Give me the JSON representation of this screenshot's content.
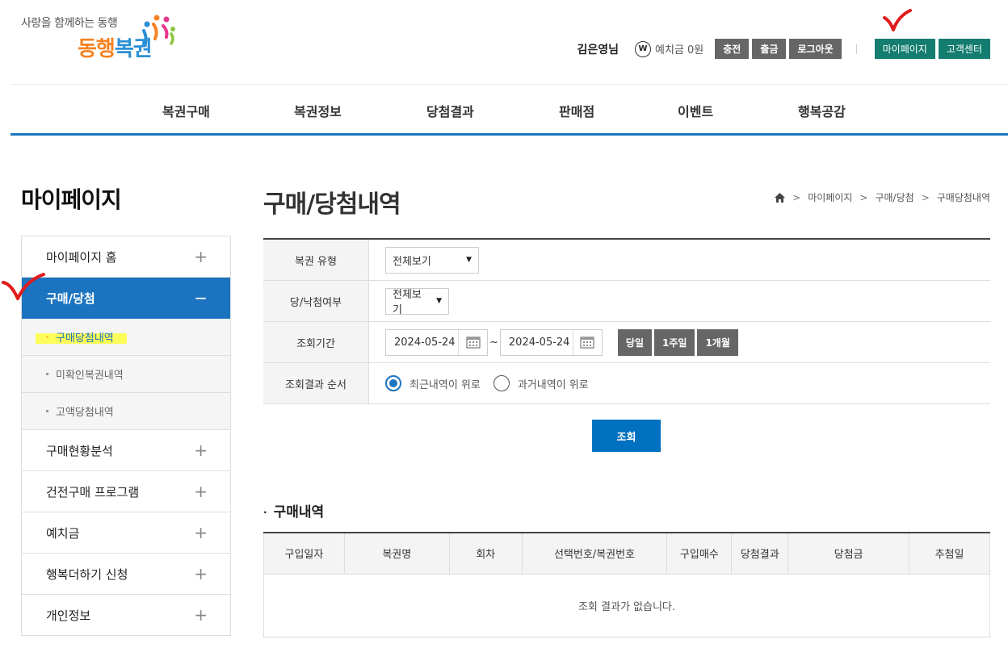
{
  "header": {
    "logo_tagline": "사랑을 함께하는 동행",
    "logo_name_1": "동행",
    "logo_name_2": "복권",
    "user_name": "김은영님",
    "w_icon_text": "W",
    "deposit_text": "예치금 0원",
    "buttons": {
      "charge": "충전",
      "withdraw": "출금",
      "logout": "로그아웃",
      "mypage": "마이페이지",
      "support": "고객센터"
    }
  },
  "gnb": [
    "복권구매",
    "복권정보",
    "당첨결과",
    "판매점",
    "이벤트",
    "행복공감"
  ],
  "sidebar": {
    "title": "마이페이지",
    "items": [
      {
        "label": "마이페이지 홈",
        "toggle": "+"
      },
      {
        "label": "구매/당첨",
        "toggle": "−"
      },
      {
        "label": "구매현황분석",
        "toggle": "+"
      },
      {
        "label": "건전구매 프로그램",
        "toggle": "+"
      },
      {
        "label": "예치금",
        "toggle": "+"
      },
      {
        "label": "행복더하기 신청",
        "toggle": "+"
      },
      {
        "label": "개인정보",
        "toggle": "+"
      }
    ],
    "subitems": [
      "구매당첨내역",
      "미확인복권내역",
      "고액당첨내역"
    ]
  },
  "main": {
    "title": "구매/당첨내역",
    "breadcrumb": [
      "마이페이지",
      "구매/당첨",
      "구매당첨내역"
    ],
    "search": {
      "lottery_type_label": "복권 유형",
      "lottery_type_value": "전체보기",
      "win_label": "당/낙첨여부",
      "win_value": "전체보기",
      "period_label": "조회기간",
      "date_from": "2024-05-24",
      "date_sep": "~",
      "date_to": "2024-05-24",
      "period_buttons": [
        "당일",
        "1주일",
        "1개월"
      ],
      "order_label": "조회결과 순서",
      "order_options": [
        "최근내역이 위로",
        "과거내역이 위로"
      ],
      "order_selected": "최근내역이 위로",
      "submit": "조회"
    },
    "history": {
      "section_bullet": "·",
      "section_title": "구매내역",
      "columns": [
        "구입일자",
        "복권명",
        "회차",
        "선택번호/복권번호",
        "구입매수",
        "당첨결과",
        "당첨금",
        "추첨일"
      ],
      "empty_message": "조회 결과가 없습니다."
    }
  },
  "colors": {
    "primary": "#1c74c0",
    "teal": "#137d6f",
    "gray_button": "#666666",
    "annotation_red": "#e21b1b",
    "highlight": "#ffff33"
  }
}
